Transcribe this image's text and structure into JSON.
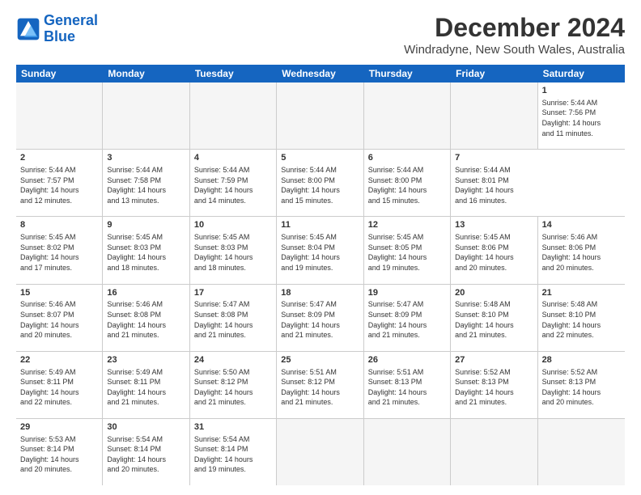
{
  "logo": {
    "line1": "General",
    "line2": "Blue"
  },
  "title": "December 2024",
  "subtitle": "Windradyne, New South Wales, Australia",
  "calendar": {
    "headers": [
      "Sunday",
      "Monday",
      "Tuesday",
      "Wednesday",
      "Thursday",
      "Friday",
      "Saturday"
    ],
    "weeks": [
      [
        {
          "day": "",
          "info": ""
        },
        {
          "day": "",
          "info": ""
        },
        {
          "day": "",
          "info": ""
        },
        {
          "day": "",
          "info": ""
        },
        {
          "day": "",
          "info": ""
        },
        {
          "day": "",
          "info": ""
        },
        {
          "day": "1",
          "info": "Sunrise: 5:44 AM\nSunset: 7:56 PM\nDaylight: 14 hours\nand 11 minutes."
        }
      ],
      [
        {
          "day": "2",
          "info": "Sunrise: 5:44 AM\nSunset: 7:57 PM\nDaylight: 14 hours\nand 12 minutes."
        },
        {
          "day": "3",
          "info": "Sunrise: 5:44 AM\nSunset: 7:58 PM\nDaylight: 14 hours\nand 13 minutes."
        },
        {
          "day": "4",
          "info": "Sunrise: 5:44 AM\nSunset: 7:59 PM\nDaylight: 14 hours\nand 14 minutes."
        },
        {
          "day": "5",
          "info": "Sunrise: 5:44 AM\nSunset: 8:00 PM\nDaylight: 14 hours\nand 15 minutes."
        },
        {
          "day": "6",
          "info": "Sunrise: 5:44 AM\nSunset: 8:00 PM\nDaylight: 14 hours\nand 15 minutes."
        },
        {
          "day": "7",
          "info": "Sunrise: 5:44 AM\nSunset: 8:01 PM\nDaylight: 14 hours\nand 16 minutes."
        }
      ],
      [
        {
          "day": "8",
          "info": "Sunrise: 5:45 AM\nSunset: 8:02 PM\nDaylight: 14 hours\nand 17 minutes."
        },
        {
          "day": "9",
          "info": "Sunrise: 5:45 AM\nSunset: 8:03 PM\nDaylight: 14 hours\nand 18 minutes."
        },
        {
          "day": "10",
          "info": "Sunrise: 5:45 AM\nSunset: 8:03 PM\nDaylight: 14 hours\nand 18 minutes."
        },
        {
          "day": "11",
          "info": "Sunrise: 5:45 AM\nSunset: 8:04 PM\nDaylight: 14 hours\nand 19 minutes."
        },
        {
          "day": "12",
          "info": "Sunrise: 5:45 AM\nSunset: 8:05 PM\nDaylight: 14 hours\nand 19 minutes."
        },
        {
          "day": "13",
          "info": "Sunrise: 5:45 AM\nSunset: 8:06 PM\nDaylight: 14 hours\nand 20 minutes."
        },
        {
          "day": "14",
          "info": "Sunrise: 5:46 AM\nSunset: 8:06 PM\nDaylight: 14 hours\nand 20 minutes."
        }
      ],
      [
        {
          "day": "15",
          "info": "Sunrise: 5:46 AM\nSunset: 8:07 PM\nDaylight: 14 hours\nand 20 minutes."
        },
        {
          "day": "16",
          "info": "Sunrise: 5:46 AM\nSunset: 8:08 PM\nDaylight: 14 hours\nand 21 minutes."
        },
        {
          "day": "17",
          "info": "Sunrise: 5:47 AM\nSunset: 8:08 PM\nDaylight: 14 hours\nand 21 minutes."
        },
        {
          "day": "18",
          "info": "Sunrise: 5:47 AM\nSunset: 8:09 PM\nDaylight: 14 hours\nand 21 minutes."
        },
        {
          "day": "19",
          "info": "Sunrise: 5:47 AM\nSunset: 8:09 PM\nDaylight: 14 hours\nand 21 minutes."
        },
        {
          "day": "20",
          "info": "Sunrise: 5:48 AM\nSunset: 8:10 PM\nDaylight: 14 hours\nand 21 minutes."
        },
        {
          "day": "21",
          "info": "Sunrise: 5:48 AM\nSunset: 8:10 PM\nDaylight: 14 hours\nand 22 minutes."
        }
      ],
      [
        {
          "day": "22",
          "info": "Sunrise: 5:49 AM\nSunset: 8:11 PM\nDaylight: 14 hours\nand 22 minutes."
        },
        {
          "day": "23",
          "info": "Sunrise: 5:49 AM\nSunset: 8:11 PM\nDaylight: 14 hours\nand 21 minutes."
        },
        {
          "day": "24",
          "info": "Sunrise: 5:50 AM\nSunset: 8:12 PM\nDaylight: 14 hours\nand 21 minutes."
        },
        {
          "day": "25",
          "info": "Sunrise: 5:51 AM\nSunset: 8:12 PM\nDaylight: 14 hours\nand 21 minutes."
        },
        {
          "day": "26",
          "info": "Sunrise: 5:51 AM\nSunset: 8:13 PM\nDaylight: 14 hours\nand 21 minutes."
        },
        {
          "day": "27",
          "info": "Sunrise: 5:52 AM\nSunset: 8:13 PM\nDaylight: 14 hours\nand 21 minutes."
        },
        {
          "day": "28",
          "info": "Sunrise: 5:52 AM\nSunset: 8:13 PM\nDaylight: 14 hours\nand 20 minutes."
        }
      ],
      [
        {
          "day": "29",
          "info": "Sunrise: 5:53 AM\nSunset: 8:14 PM\nDaylight: 14 hours\nand 20 minutes."
        },
        {
          "day": "30",
          "info": "Sunrise: 5:54 AM\nSunset: 8:14 PM\nDaylight: 14 hours\nand 20 minutes."
        },
        {
          "day": "31",
          "info": "Sunrise: 5:54 AM\nSunset: 8:14 PM\nDaylight: 14 hours\nand 19 minutes."
        },
        {
          "day": "",
          "info": ""
        },
        {
          "day": "",
          "info": ""
        },
        {
          "day": "",
          "info": ""
        },
        {
          "day": "",
          "info": ""
        }
      ]
    ]
  }
}
